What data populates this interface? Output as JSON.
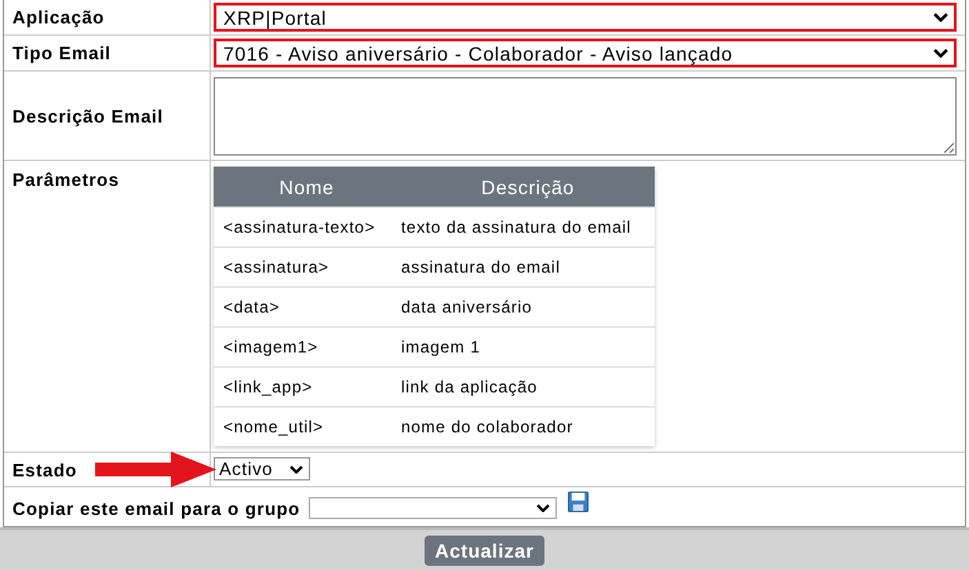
{
  "form": {
    "rows": [
      {
        "kind": "select",
        "label": "Aplicação",
        "value": "XRP|Portal",
        "highlighted": true
      },
      {
        "kind": "select",
        "label": "Tipo Email",
        "value": "7016 - Aviso aniversário - Colaborador - Aviso lançado",
        "highlighted": true
      },
      {
        "kind": "textarea",
        "label": "Descrição Email"
      },
      {
        "kind": "params",
        "label": "Parâmetros"
      },
      {
        "kind": "small-select",
        "label": "Estado",
        "value": "Activo",
        "pointed": true
      }
    ],
    "copy": {
      "label": "Copiar este email para o grupo"
    }
  },
  "params": {
    "columns": [
      "Nome",
      "Descrição"
    ],
    "rows": [
      {
        "name": "<assinatura-texto>",
        "description": "texto da assinatura do email"
      },
      {
        "name": "<assinatura>",
        "description": "assinatura do email"
      },
      {
        "name": "<data>",
        "description": "data aniversário"
      },
      {
        "name": "<imagem1>",
        "description": "imagem 1"
      },
      {
        "name": "<link_app>",
        "description": "link da aplicação"
      },
      {
        "name": "<nome_util>",
        "description": "nome do colaborador"
      }
    ]
  },
  "footer": {
    "button": "Actualizar"
  }
}
